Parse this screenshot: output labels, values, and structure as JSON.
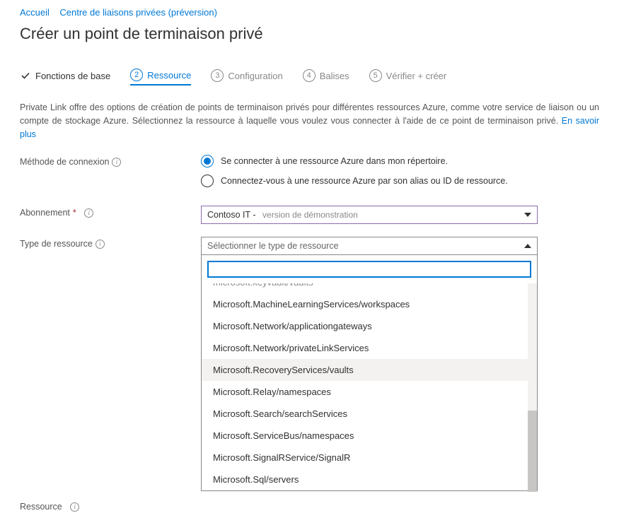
{
  "breadcrumb": {
    "home": "Accueil",
    "center": "Centre de liaisons privées (préversion)"
  },
  "title": "Créer un point de terminaison privé",
  "tabs": {
    "t1": "Fonctions de base",
    "t2": "Ressource",
    "t3": "Configuration",
    "t4": "Balises",
    "t5": "Vérifier + créer",
    "n2": "2",
    "n3": "3",
    "n4": "4",
    "n5": "5"
  },
  "description": {
    "text": "Private Link offre des options de création de points de terminaison privés pour différentes ressources Azure, comme votre service de liaison ou un compte de stockage Azure. Sélectionnez la ressource à laquelle vous voulez vous connecter à l'aide de ce point de terminaison privé. ",
    "link": "En savoir plus"
  },
  "labels": {
    "method": "Méthode de connexion",
    "subscription": "Abonnement",
    "resourceType": "Type de ressource",
    "resource": "Ressource",
    "required": "*"
  },
  "connection": {
    "opt1": "Se connecter à une ressource Azure dans mon répertoire.",
    "opt2": "Connectez-vous à une ressource Azure par son alias ou ID de ressource."
  },
  "subscription": {
    "prefix": "Contoso IT -",
    "suffix": "version de démonstration"
  },
  "resourceType": {
    "placeholder": "Sélectionner le type de ressource",
    "truncated": "microsoft.keyvault/vaults",
    "options": [
      "Microsoft.MachineLearningServices/workspaces",
      "Microsoft.Network/applicationgateways",
      "Microsoft.Network/privateLinkServices",
      "Microsoft.RecoveryServices/vaults",
      "Microsoft.Relay/namespaces",
      "Microsoft.Search/searchServices",
      "Microsoft.ServiceBus/namespaces",
      "Microsoft.SignalRService/SignalR",
      "Microsoft.Sql/servers"
    ],
    "hoveredIndex": 3
  }
}
